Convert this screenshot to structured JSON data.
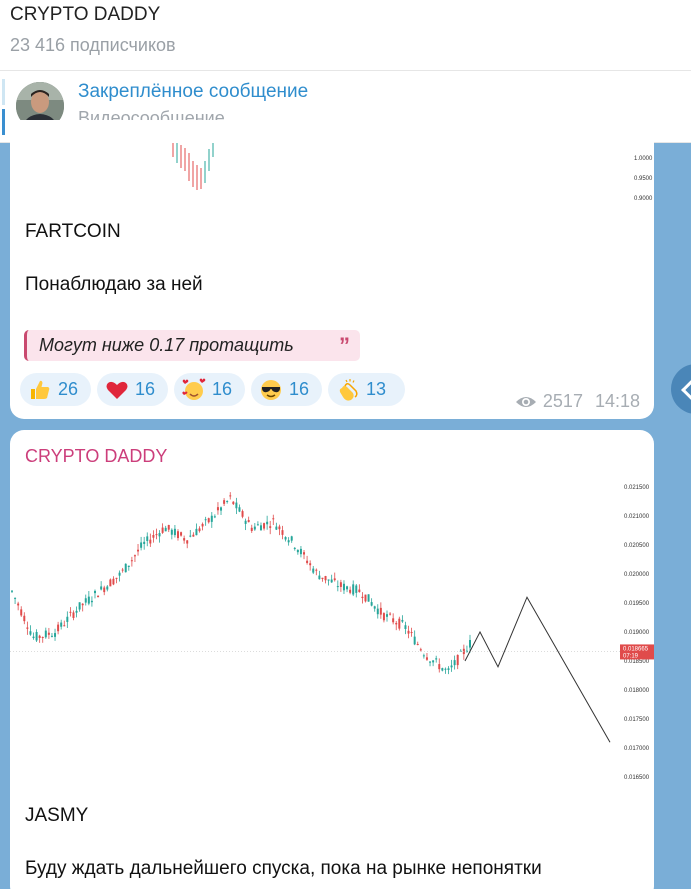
{
  "header": {
    "title": "CRYPTO DADDY",
    "subscribers": "23 416 подписчиков"
  },
  "pinned": {
    "title": "Закреплённое сообщение",
    "text": "Видеосообщение"
  },
  "message1": {
    "chart_ticks": [
      "1.0000",
      "0.9500",
      "0.9000"
    ],
    "ticker": "FARTCOIN",
    "text": "Понаблюдаю за ней",
    "quote": "Могут ниже 0.17 протащить",
    "reactions": [
      {
        "icon": "thumbs-up-icon",
        "count": "26"
      },
      {
        "icon": "red-heart-icon",
        "count": "16"
      },
      {
        "icon": "smiling-face-with-hearts-icon",
        "count": "16"
      },
      {
        "icon": "sunglasses-face-icon",
        "count": "16"
      },
      {
        "icon": "clapping-hands-icon",
        "count": "13"
      }
    ],
    "views": "2517",
    "time": "14:18"
  },
  "message2": {
    "sender": "CRYPTO DADDY",
    "ticker": "JASMY",
    "text": "Буду ждать дальнейшего спуска, пока на рынке непонятки"
  },
  "chart_data": {
    "type": "line",
    "title": "",
    "xlabel": "",
    "ylabel": "",
    "ylim": [
      0.0165,
      0.0215
    ],
    "y_ticks": [
      "0.021500",
      "0.021000",
      "0.020500",
      "0.020000",
      "0.019500",
      "0.019000",
      "0.018500",
      "0.018000",
      "0.017500",
      "0.017000",
      "0.016500"
    ],
    "current_price": {
      "value": "0.018665",
      "timer": "07:19"
    },
    "series": [
      {
        "values": [
          0.0197,
          0.0189,
          0.019,
          0.0194,
          0.0197,
          0.02,
          0.0205,
          0.0208,
          0.0206,
          0.0209,
          0.0213,
          0.0208,
          0.0209,
          0.0205,
          0.02,
          0.0198,
          0.0197,
          0.0193,
          0.0191,
          0.0186,
          0.0183,
          0.0188
        ]
      },
      {
        "values": [
          0.0185,
          0.019,
          0.0184,
          0.0196,
          0.0171
        ]
      }
    ]
  }
}
